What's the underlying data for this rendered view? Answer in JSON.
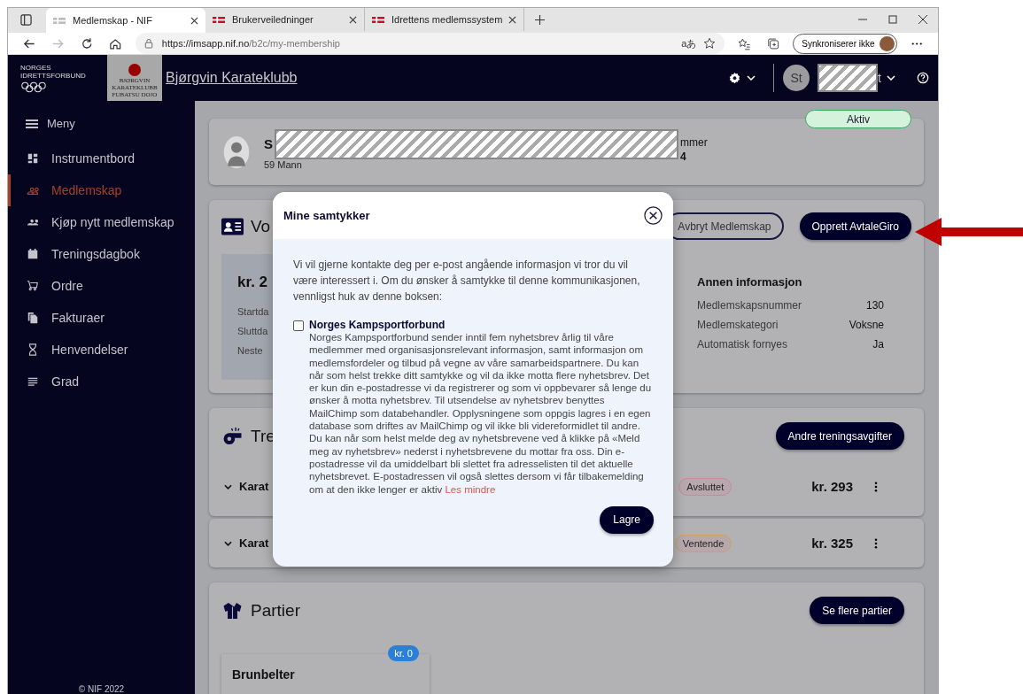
{
  "browser": {
    "tabs": [
      {
        "title": "Medlemskap - NIF",
        "selected": true
      },
      {
        "title": "Brukerveiledninger",
        "selected": false
      },
      {
        "title": "Idrettens medlemssystem",
        "selected": false
      }
    ],
    "url_host": "https://imsapp.nif.no",
    "url_path": "/b2c/my-membership",
    "translate_glyph": "aあ",
    "sync_label": "Synkroniserer ikke"
  },
  "header": {
    "federation_logo_lines": [
      "NORGES",
      "IDRETTSFORBUND"
    ],
    "club_logo_lines": [
      "BJØRGVIN",
      "KARATEKLUBB",
      "FUBATSU DOJO"
    ],
    "club_name": "Bjørgvin Karateklubb",
    "user_initials": "St",
    "user_name_tail": "t"
  },
  "sidebar": {
    "menu_label": "Meny",
    "items": [
      {
        "label": "Instrumentbord",
        "selected": false
      },
      {
        "label": "Medlemskap",
        "selected": true
      },
      {
        "label": "Kjøp nytt medlemskap",
        "selected": false
      },
      {
        "label": "Treningsdagbok",
        "selected": false
      },
      {
        "label": "Ordre",
        "selected": false
      },
      {
        "label": "Fakturaer",
        "selected": false
      },
      {
        "label": "Henvendelser",
        "selected": false
      },
      {
        "label": "Grad",
        "selected": false
      }
    ],
    "footer": "© NIF 2022"
  },
  "profile": {
    "name_fragment": "S",
    "age_gender_fragment": "59 Mann",
    "number_label_fragment": "mmer",
    "number_fragment": "4",
    "status": "Aktiv"
  },
  "membership": {
    "heading_fragment": "Vo",
    "cancel_button": "Avbryt Medlemskap",
    "avtalegiro_button": "Opprett AvtaleGiro",
    "price_fragment": "kr. 2",
    "date_labels": [
      "Startda",
      "Sluttda",
      "Neste"
    ],
    "other_info": {
      "heading": "Annen informasjon",
      "rows": [
        {
          "label": "Medlemskapsnummer",
          "value": "130"
        },
        {
          "label": "Medlemskategori",
          "value": "Voksne"
        },
        {
          "label": "Automatisk fornyes",
          "value": "Ja"
        }
      ]
    }
  },
  "training": {
    "heading_fragment": "Tre",
    "button": "Andre treningsavgifter",
    "rows": [
      {
        "name_fragment": "Karat",
        "status": "Avsluttet",
        "color": "#c98a9b",
        "price": "kr. 293"
      },
      {
        "name_fragment": "Karat",
        "status": "Ventende",
        "color": "#c9a55a",
        "price": "kr. 325"
      }
    ]
  },
  "parties": {
    "heading": "Partier",
    "button": "Se flere partier",
    "cards": [
      {
        "name": "Brunbelter",
        "price": "kr. 0"
      }
    ]
  },
  "modal": {
    "title": "Mine samtykker",
    "intro": "Vi vil gjerne kontakte deg per e-post angående informasjon vi tror du vil være interessert i. Om du ønsker å samtykke til denne kommunikasjonen, vennligst huk av denne boksen:",
    "consents": [
      {
        "title": "Norges Kampsportforbund",
        "checked": false,
        "text": "Norges Kampsportforbund sender inntil fem nyhetsbrev årlig til våre medlemmer med organisasjonsrelevant informasjon, samt informasjon om medlemsfordeler og tilbud på vegne av våre samarbeidspartnere. Du kan når som helst trekke ditt samtykke og vil da ikke motta flere nyhetsbrev. Det er kun din e-postadresse vi da registrerer og som vi oppbevarer så lenge du ønsker å motta nyhetsbrev. Til utsendelse av nyhetsbrev benyttes MailChimp som databehandler. Opplysningene som oppgis lagres i en egen database som driftes av MailChimp og vil ikke bli videreformidlet til andre. Du kan når som helst melde deg av nyhetsbrevene ved å klikke på «Meld meg av nyhetsbrev» nederst i nyhetsbrevene du mottar fra oss. Din e-postadresse vil da umiddelbart bli slettet fra adresselisten til det aktuelle nyhetsbrevet. E-postadressen vil også slettes dersom vi får tilbakemelding om at den ikke lenger er aktiv",
        "link": "Les mindre"
      }
    ],
    "save_button": "Lagre"
  }
}
